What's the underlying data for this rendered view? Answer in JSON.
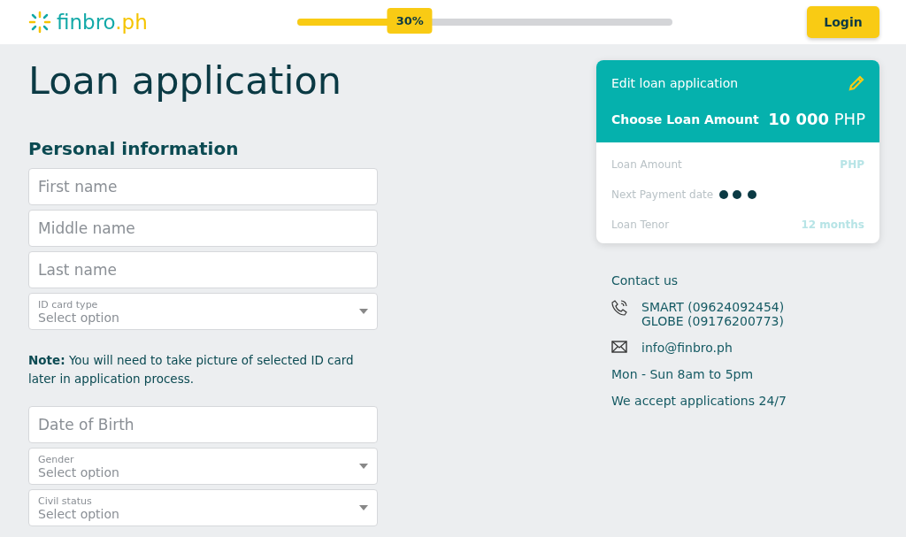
{
  "header": {
    "logo": {
      "name": "finbro",
      "suffix": ".ph"
    },
    "progress": {
      "level": 0.3,
      "label": "30%"
    },
    "login_button": "Login"
  },
  "title": "Loan application",
  "section_title": "Personal information",
  "fields_group_1": [
    {
      "kind": "text",
      "placeholder": "First name"
    },
    {
      "kind": "text",
      "placeholder": "Middle name"
    },
    {
      "kind": "text",
      "placeholder": "Last name"
    },
    {
      "kind": "select",
      "label": "ID card type",
      "placeholder": "Select option"
    }
  ],
  "note": "**Note:** You will need to take picture of selected ID card later in application process.",
  "fields_group_2": [
    {
      "kind": "text",
      "placeholder": "Date of Birth"
    },
    {
      "kind": "select",
      "label": "Gender",
      "placeholder": "Select option"
    },
    {
      "kind": "select",
      "label": "Civil status",
      "placeholder": "Select option"
    }
  ],
  "loan_card": {
    "edit_label": "Edit loan application",
    "choose_label": "Choose Loan Amount",
    "amount": "10 000",
    "currency": "PHP",
    "rows": [
      {
        "kind": "text",
        "label": "Loan Amount",
        "value": "PHP"
      },
      {
        "kind": "loading",
        "label": "Next Payment date"
      },
      {
        "kind": "text",
        "label": "Loan Tenor",
        "value": "12 months"
      }
    ]
  },
  "contact": {
    "title": "Contact us",
    "phones": [
      "SMART (09624092454)",
      "GLOBE (09176200773)"
    ],
    "email": "info@finbro.ph",
    "hours": "Mon - Sun 8am to 5pm",
    "availability": "We accept applications 24/7"
  }
}
